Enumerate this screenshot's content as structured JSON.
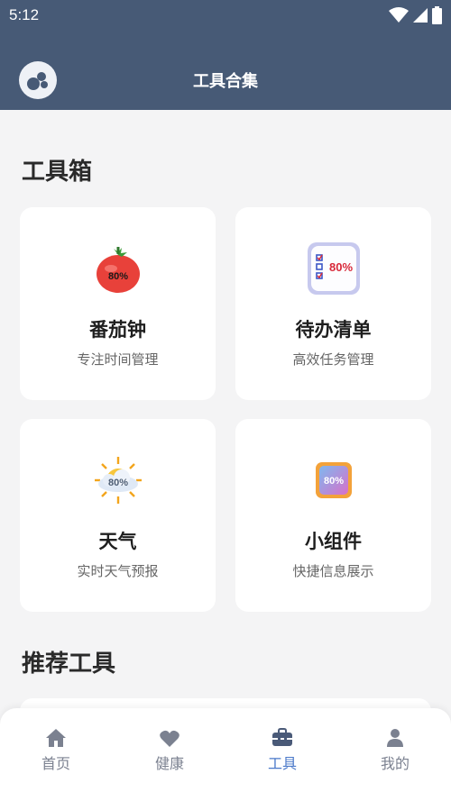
{
  "status_bar": {
    "time": "5:12"
  },
  "header": {
    "title": "工具合集",
    "logo": "bubbles-logo-icon"
  },
  "toolbox": {
    "title": "工具箱",
    "cards": [
      {
        "title": "番茄钟",
        "subtitle": "专注时间管理",
        "icon": "tomato-icon",
        "badge": "80%"
      },
      {
        "title": "待办清单",
        "subtitle": "高效任务管理",
        "icon": "checklist-icon",
        "badge": "80%"
      },
      {
        "title": "天气",
        "subtitle": "实时天气预报",
        "icon": "weather-cloud-sun-icon",
        "badge": "80%"
      },
      {
        "title": "小组件",
        "subtitle": "快捷信息展示",
        "icon": "widget-icon",
        "badge": "80%"
      }
    ]
  },
  "recommended": {
    "title": "推荐工具"
  },
  "bottom_nav": {
    "items": [
      {
        "label": "首页",
        "icon": "home-icon"
      },
      {
        "label": "健康",
        "icon": "heart-icon"
      },
      {
        "label": "工具",
        "icon": "toolbox-icon",
        "active": true
      },
      {
        "label": "我的",
        "icon": "user-icon"
      }
    ]
  },
  "colors": {
    "header_bg": "#475a76",
    "active_nav": "#4a78c9",
    "inactive_nav": "#7b8190",
    "page_bg": "#f4f4f5"
  }
}
